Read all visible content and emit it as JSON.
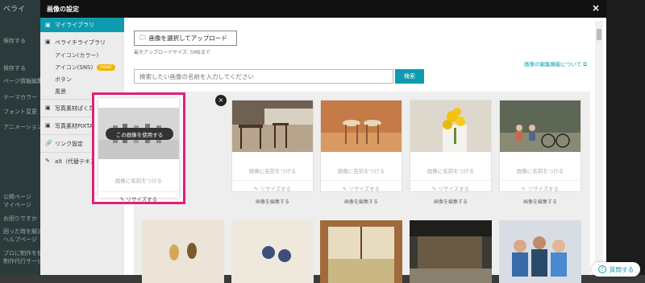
{
  "background": {
    "sidebar_labels": [
      "ベライ",
      "保存する",
      "保存する",
      "ページ情報編集",
      "テーマカラー",
      "フォント変更",
      "アニメーション",
      "公開ページ",
      "マイページ",
      "お困りですか",
      "困った時を解決",
      "ヘルプページ",
      "プロに制作を依頼",
      "制作代行サービス"
    ]
  },
  "modal": {
    "title": "画像の設定",
    "close_label": "×"
  },
  "sidebar": {
    "items": [
      {
        "label": "マイライブラリ",
        "icon": "image-icon",
        "active": true
      },
      {
        "label": "ペライチライブラリ",
        "icon": "image-icon",
        "active": false
      }
    ],
    "sub_items": [
      {
        "label": "アイコン(カラー)"
      },
      {
        "label": "アイコン(SNS)",
        "badge": "new!"
      },
      {
        "label": "ボタン"
      },
      {
        "label": "風景"
      }
    ],
    "more_items": [
      {
        "label": "写真素材ぱくたそ",
        "icon": "image-icon"
      },
      {
        "label": "写真素材PIXTA",
        "icon": "image-icon"
      },
      {
        "label": "リンク設定",
        "icon": "link-icon"
      },
      {
        "label": "alt（代替テキスト）設定",
        "icon": "pencil-icon"
      }
    ]
  },
  "toolbar": {
    "upload_label": "画像を選択してアップロード",
    "upload_size_note": "最大アップロードサイズ: 5MBまで",
    "edit_link": "画像の編集機能について"
  },
  "search": {
    "placeholder": "検索したい画像の名前を入力してください",
    "button_label": "検索"
  },
  "cards": {
    "use_image_label": "この画像を使用する",
    "name_placeholder": "画像に名前をつける",
    "resize_label": "リサイズする",
    "edit_label": "画像を編集する"
  },
  "help": {
    "label": "質問する"
  },
  "colors": {
    "accent": "#0e9bb0",
    "highlight": "#e0207a"
  }
}
